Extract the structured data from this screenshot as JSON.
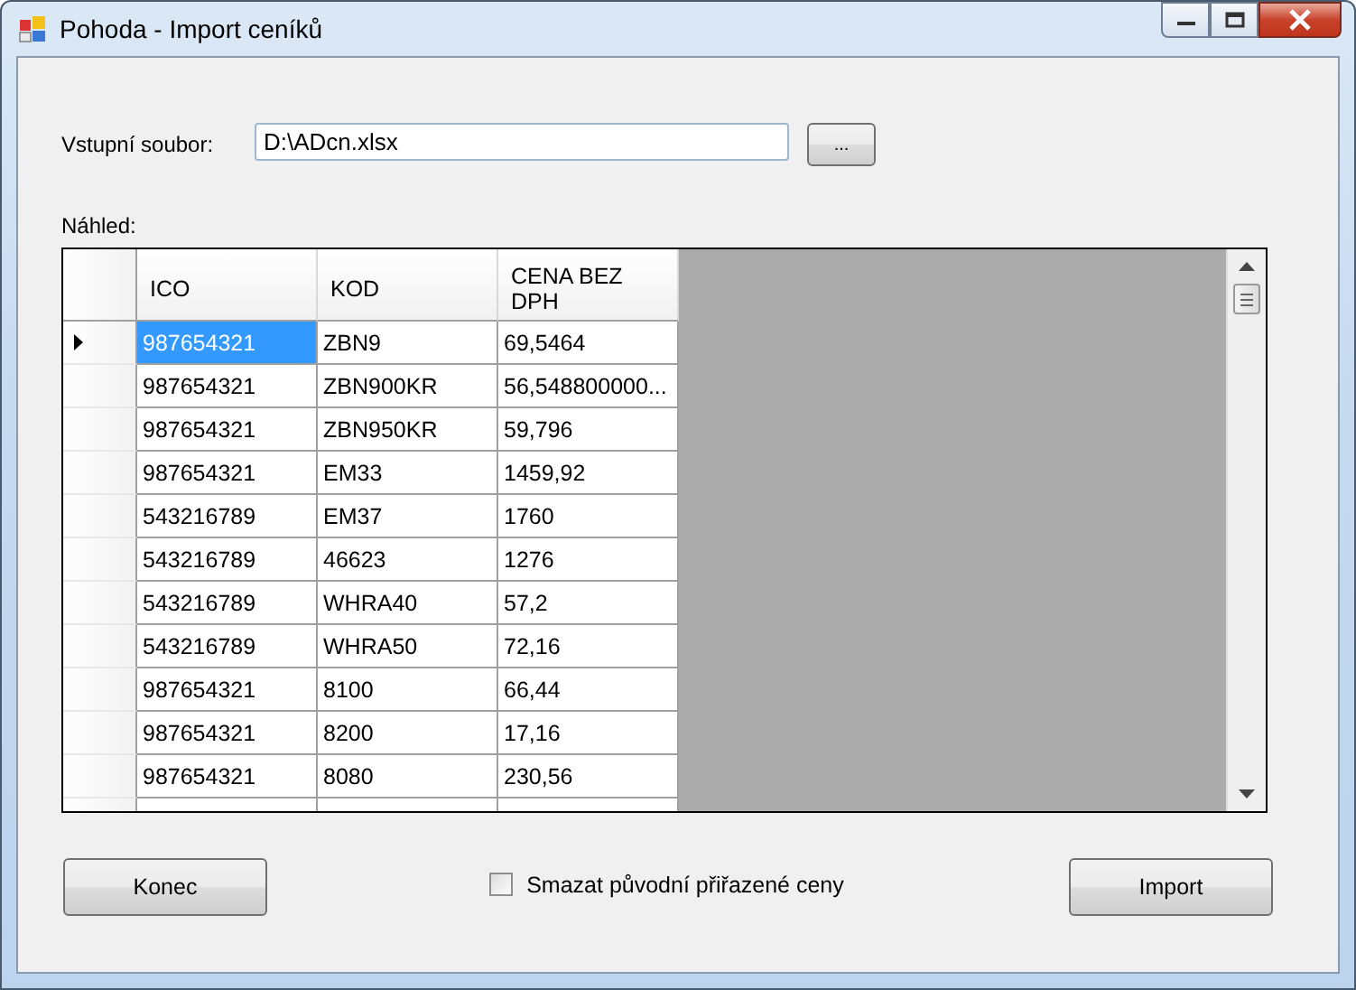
{
  "window": {
    "title": "Pohoda - Import ceníků"
  },
  "input_file": {
    "label": "Vstupní soubor:",
    "value": "D:\\ADcn.xlsx",
    "browse_button": "..."
  },
  "preview": {
    "label": "Náhled:",
    "columns": [
      "ICO",
      "KOD",
      "CENA BEZ DPH"
    ],
    "rows": [
      {
        "selected": true,
        "cells": [
          "987654321",
          "ZBN9",
          "69,5464"
        ]
      },
      {
        "selected": false,
        "cells": [
          "987654321",
          "ZBN900KR",
          "56,548800000..."
        ]
      },
      {
        "selected": false,
        "cells": [
          "987654321",
          "ZBN950KR",
          "59,796"
        ]
      },
      {
        "selected": false,
        "cells": [
          "987654321",
          "EM33",
          "1459,92"
        ]
      },
      {
        "selected": false,
        "cells": [
          "543216789",
          "EM37",
          "1760"
        ]
      },
      {
        "selected": false,
        "cells": [
          "543216789",
          "46623",
          "1276"
        ]
      },
      {
        "selected": false,
        "cells": [
          "543216789",
          "WHRA40",
          "57,2"
        ]
      },
      {
        "selected": false,
        "cells": [
          "543216789",
          "WHRA50",
          "72,16"
        ]
      },
      {
        "selected": false,
        "cells": [
          "987654321",
          "8100",
          "66,44"
        ]
      },
      {
        "selected": false,
        "cells": [
          "987654321",
          "8200",
          "17,16"
        ]
      },
      {
        "selected": false,
        "cells": [
          "987654321",
          "8080",
          "230,56"
        ]
      }
    ]
  },
  "buttons": [
    {
      "label": "Konec"
    },
    {
      "label": "Import"
    }
  ],
  "delete_option": {
    "label": "Smazat původní přiřazené ceny",
    "checked": false
  }
}
